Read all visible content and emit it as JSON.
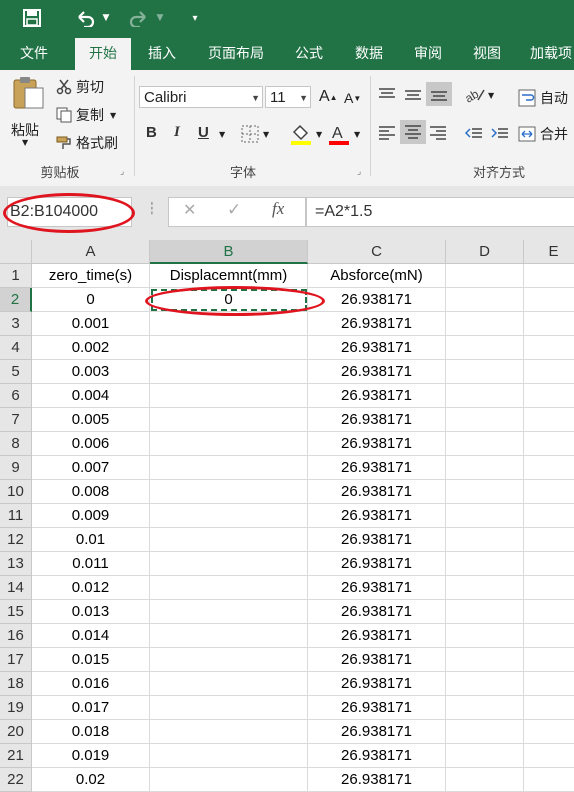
{
  "quick_access": {
    "save_icon": "save-icon",
    "undo_icon": "undo-icon",
    "redo_icon": "redo-icon",
    "customize_icon": "customize-icon"
  },
  "tabs": [
    "文件",
    "开始",
    "插入",
    "页面布局",
    "公式",
    "数据",
    "审阅",
    "视图",
    "加载项"
  ],
  "active_tab": "开始",
  "clipboard": {
    "paste": "粘贴",
    "cut": "剪切",
    "copy": "复制",
    "format_painter": "格式刷",
    "group": "剪贴板"
  },
  "font": {
    "name": "Calibri",
    "size": "11",
    "group": "字体",
    "bold": "B",
    "italic": "I",
    "underline": "U",
    "grow": "A",
    "shrink": "A"
  },
  "alignment": {
    "wrap": "自动",
    "merge": "合并",
    "group": "对齐方式"
  },
  "colors": {
    "excel_green": "#217346",
    "font_color_bar": "#ff0000",
    "highlight_bar": "#ffff00",
    "annotation_red": "#e0141e"
  },
  "name_box": "B2:B104000",
  "formula": "=A2*1.5",
  "columns": [
    "A",
    "B",
    "C",
    "D",
    "E"
  ],
  "rows": [
    {
      "n": "1",
      "a": "zero_time(s)",
      "b": "Displacemnt(mm)",
      "c": "Absforce(mN)"
    },
    {
      "n": "2",
      "a": "0",
      "b": "0",
      "c": "26.938171"
    },
    {
      "n": "3",
      "a": "0.001",
      "b": "",
      "c": "26.938171"
    },
    {
      "n": "4",
      "a": "0.002",
      "b": "",
      "c": "26.938171"
    },
    {
      "n": "5",
      "a": "0.003",
      "b": "",
      "c": "26.938171"
    },
    {
      "n": "6",
      "a": "0.004",
      "b": "",
      "c": "26.938171"
    },
    {
      "n": "7",
      "a": "0.005",
      "b": "",
      "c": "26.938171"
    },
    {
      "n": "8",
      "a": "0.006",
      "b": "",
      "c": "26.938171"
    },
    {
      "n": "9",
      "a": "0.007",
      "b": "",
      "c": "26.938171"
    },
    {
      "n": "10",
      "a": "0.008",
      "b": "",
      "c": "26.938171"
    },
    {
      "n": "11",
      "a": "0.009",
      "b": "",
      "c": "26.938171"
    },
    {
      "n": "12",
      "a": "0.01",
      "b": "",
      "c": "26.938171"
    },
    {
      "n": "13",
      "a": "0.011",
      "b": "",
      "c": "26.938171"
    },
    {
      "n": "14",
      "a": "0.012",
      "b": "",
      "c": "26.938171"
    },
    {
      "n": "15",
      "a": "0.013",
      "b": "",
      "c": "26.938171"
    },
    {
      "n": "16",
      "a": "0.014",
      "b": "",
      "c": "26.938171"
    },
    {
      "n": "17",
      "a": "0.015",
      "b": "",
      "c": "26.938171"
    },
    {
      "n": "18",
      "a": "0.016",
      "b": "",
      "c": "26.938171"
    },
    {
      "n": "19",
      "a": "0.017",
      "b": "",
      "c": "26.938171"
    },
    {
      "n": "20",
      "a": "0.018",
      "b": "",
      "c": "26.938171"
    },
    {
      "n": "21",
      "a": "0.019",
      "b": "",
      "c": "26.938171"
    },
    {
      "n": "22",
      "a": "0.02",
      "b": "",
      "c": "26.938171"
    }
  ]
}
